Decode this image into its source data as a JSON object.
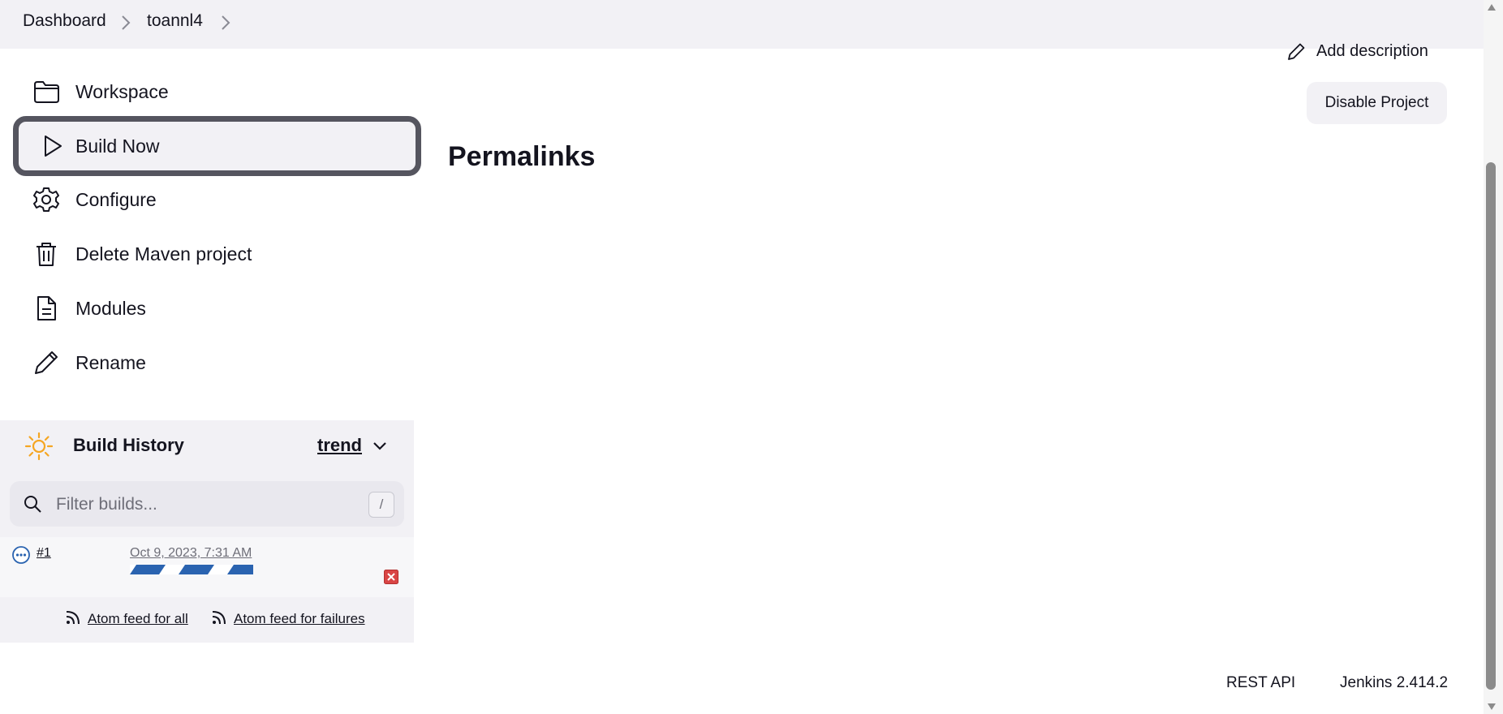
{
  "breadcrumb": {
    "items": [
      "Dashboard",
      "toannl4"
    ]
  },
  "sidebar": {
    "tasks": [
      {
        "label": "Workspace",
        "icon": "folder-icon"
      },
      {
        "label": "Build Now",
        "icon": "play-icon"
      },
      {
        "label": "Configure",
        "icon": "gear-icon"
      },
      {
        "label": "Delete Maven project",
        "icon": "trash-icon"
      },
      {
        "label": "Modules",
        "icon": "document-icon"
      },
      {
        "label": "Rename",
        "icon": "pencil-icon"
      }
    ]
  },
  "build_history": {
    "title": "Build History",
    "trend_label": "trend",
    "filter_placeholder": "Filter builds...",
    "filter_shortcut": "/",
    "builds": [
      {
        "number": "#1",
        "date": "Oct 9, 2023, 7:31 AM",
        "status": "in-progress"
      }
    ],
    "feed_all": "Atom feed for all",
    "feed_failures": "Atom feed for failures"
  },
  "main": {
    "add_description": "Add description",
    "disable_project": "Disable Project",
    "permalinks_heading": "Permalinks"
  },
  "footer": {
    "rest_api": "REST API",
    "version": "Jenkins 2.414.2"
  },
  "colors": {
    "accent_sun": "#f5a623",
    "progress_blue": "#2a63b0",
    "abort_red": "#d94545",
    "active_border": "#55555f"
  }
}
